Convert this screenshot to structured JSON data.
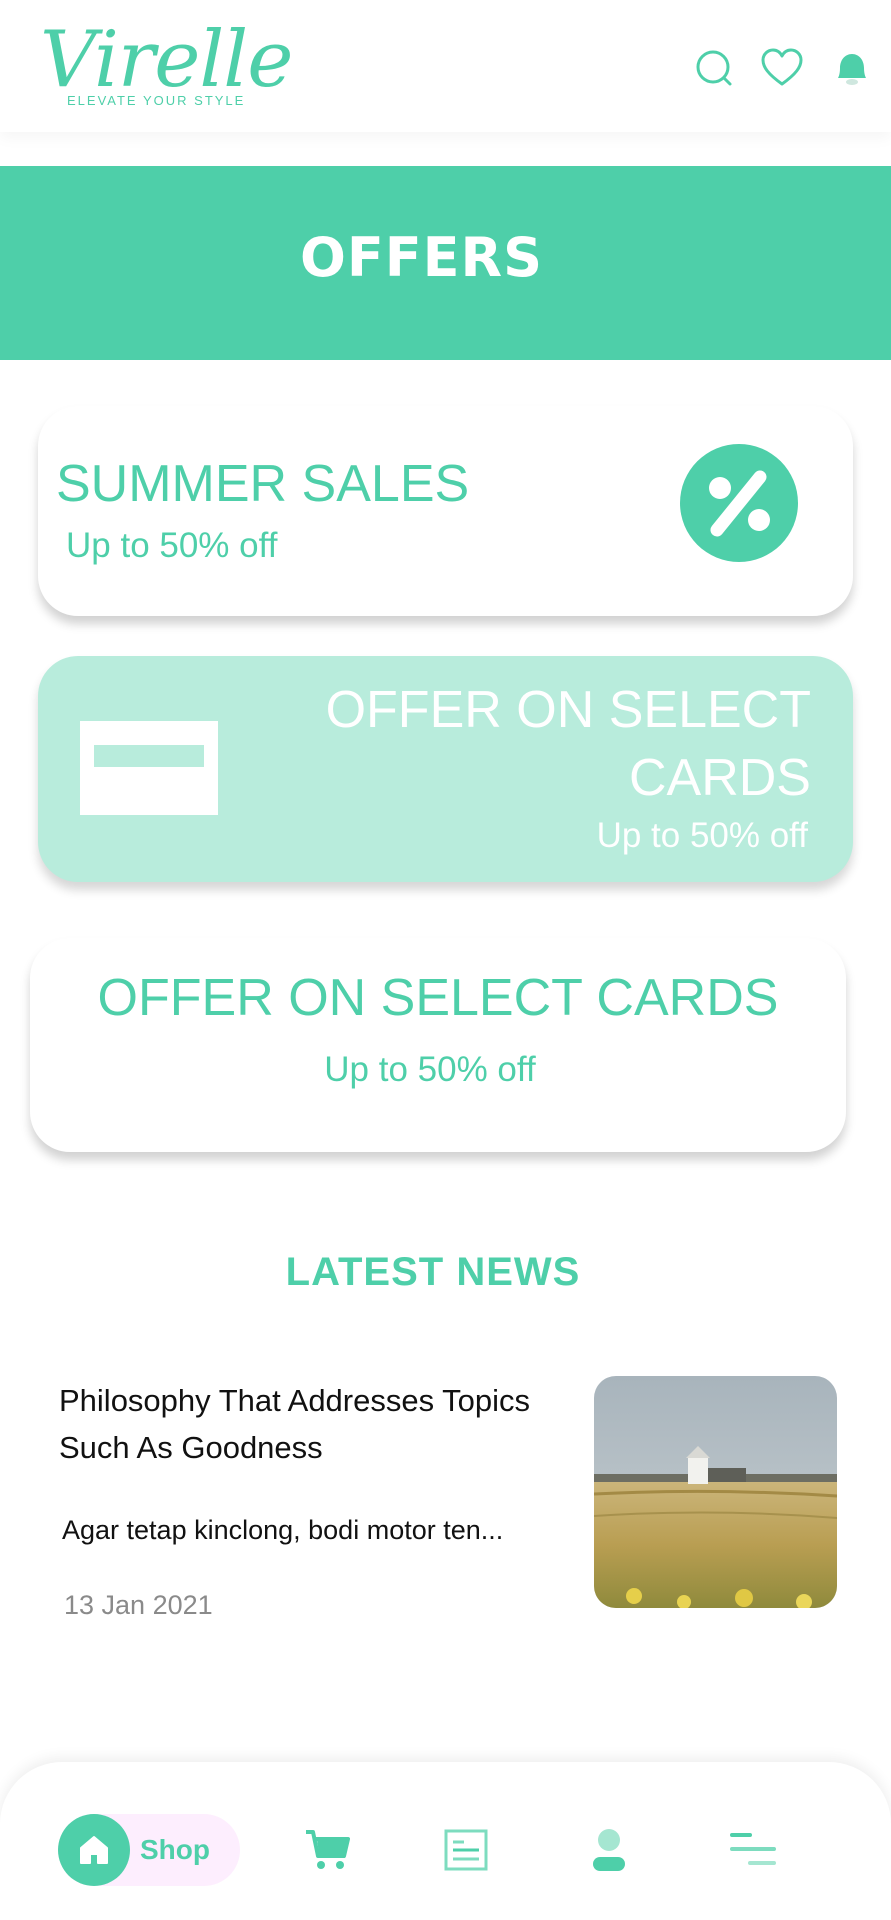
{
  "header": {
    "logo_text": "Virelle",
    "tagline": "ELEVATE YOUR STYLE",
    "icons": [
      "search-icon",
      "heart-icon",
      "bell-icon"
    ]
  },
  "banner": {
    "title": "OFFERS"
  },
  "offers": [
    {
      "title": "SUMMER SALES",
      "subtitle": "Up to 50% off",
      "icon": "percent-icon"
    },
    {
      "title": "OFFER ON SELECT CARDS",
      "subtitle": "Up to 50% off",
      "icon": "credit-card-icon"
    },
    {
      "title": "OFFER ON SELECT CARDS",
      "subtitle": "Up to 50% off"
    }
  ],
  "news": {
    "heading": "LATEST NEWS",
    "items": [
      {
        "title": "Philosophy That Addresses Topics Such As Goodness",
        "excerpt": "Agar tetap kinclong, bodi motor ten...",
        "date": "13 Jan 2021",
        "image": "field-farmhouse-photo"
      }
    ]
  },
  "bottom_nav": {
    "items": [
      {
        "label": "Shop",
        "icon": "home-icon",
        "active": true
      },
      {
        "icon": "cart-icon"
      },
      {
        "icon": "list-icon"
      },
      {
        "icon": "profile-icon"
      },
      {
        "icon": "menu-icon"
      }
    ]
  },
  "colors": {
    "accent": "#4ecfa9",
    "accent_light": "#b8ecdc",
    "shop_pill": "#fdeefe"
  }
}
